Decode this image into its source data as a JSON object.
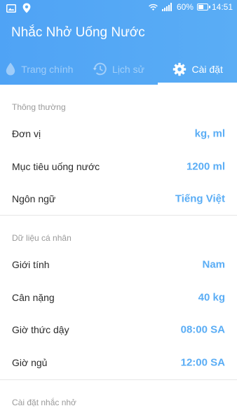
{
  "status_bar": {
    "battery": "60%",
    "battery_level": 0.6,
    "time": "14:51"
  },
  "app": {
    "title": "Nhắc Nhở Uống Nước"
  },
  "tabs": [
    {
      "label": "Trang chính",
      "icon": "water-drop-icon",
      "active": false
    },
    {
      "label": "Lịch sử",
      "icon": "history-icon",
      "active": false
    },
    {
      "label": "Cài đặt",
      "icon": "gear-icon",
      "active": true
    }
  ],
  "sections": {
    "general": {
      "title": "Thông thường",
      "rows": [
        {
          "label": "Đơn vị",
          "value": "kg, ml"
        },
        {
          "label": "Mục tiêu uống nước",
          "value": "1200 ml"
        },
        {
          "label": "Ngôn ngữ",
          "value": "Tiếng Việt"
        }
      ]
    },
    "personal": {
      "title": "Dữ liệu cá nhân",
      "rows": [
        {
          "label": "Giới tính",
          "value": "Nam"
        },
        {
          "label": "Cân nặng",
          "value": "40 kg"
        },
        {
          "label": "Giờ thức dậy",
          "value": "08:00 SA"
        },
        {
          "label": "Giờ ngủ",
          "value": "12:00 SA"
        }
      ]
    },
    "reminder": {
      "title": "Cài đặt nhắc nhở"
    }
  },
  "colors": {
    "primary": "#5AADF5",
    "header_gradient_start": "#4FA3F5",
    "text": "#2a2a2a",
    "section_header": "#9a9a9a"
  }
}
